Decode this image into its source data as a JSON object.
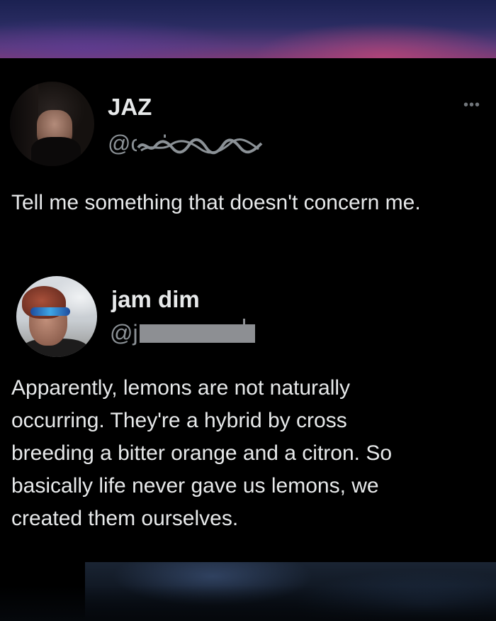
{
  "tweets": [
    {
      "name": "JAZ",
      "handle": "@carlaxnxx",
      "text": "Tell me something that doesn't concern me."
    },
    {
      "name": "jam dim",
      "handle": "@j",
      "text": "Apparently, lemons are not naturally occurring. They're a hybrid by cross breeding a bitter orange and a citron. So basically life never gave us lemons, we created them ourselves."
    }
  ],
  "more_icon": "more-horizontal-icon",
  "colors": {
    "background": "#000000",
    "text": "#e7e9ea",
    "secondary": "#8b9196",
    "redaction": "#8d8f93"
  }
}
